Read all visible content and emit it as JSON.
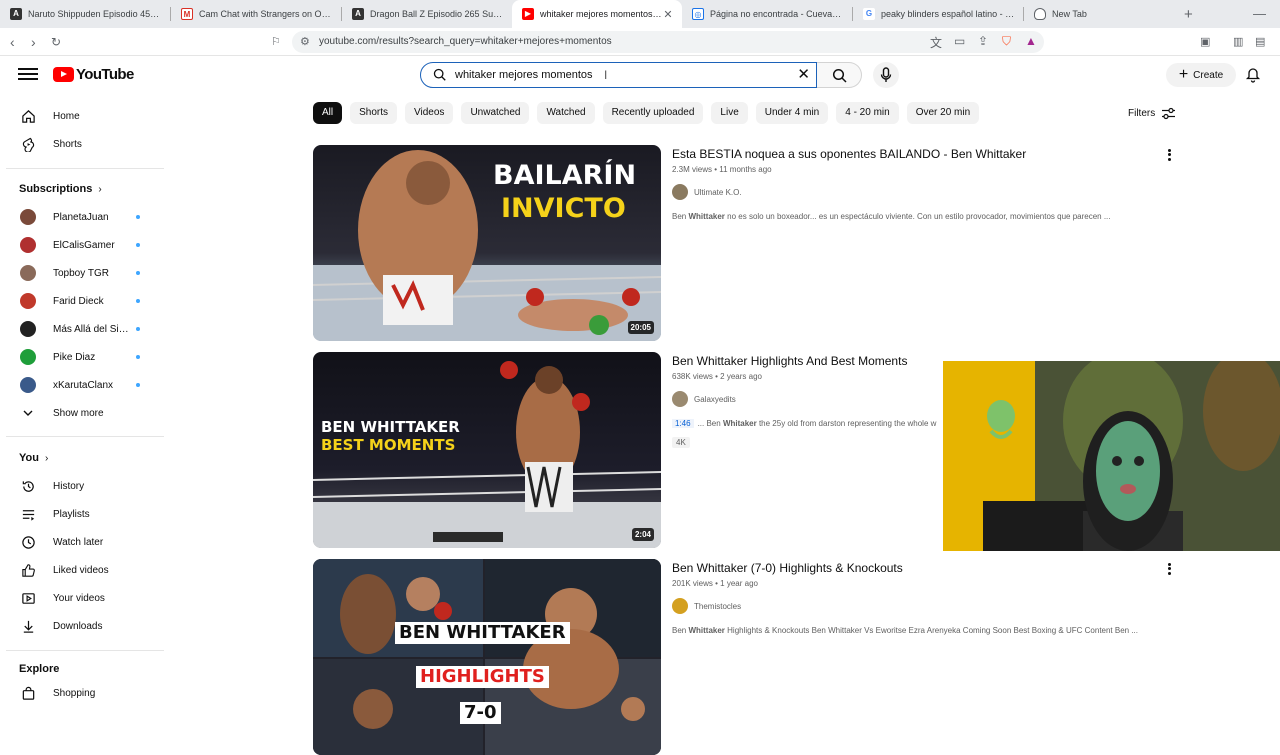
{
  "browser": {
    "tabs": [
      {
        "title": "Naruto Shippuden Episodio 459 Sub",
        "favicon": "af-icon",
        "active": false
      },
      {
        "title": "Cam Chat with Strangers on OmeTV",
        "favicon": "gmail-icon",
        "active": false
      },
      {
        "title": "Dragon Ball Z Episodio 265 Sub Espa",
        "favicon": "af-icon",
        "active": false
      },
      {
        "title": "whitaker mejores momentos - Y",
        "favicon": "youtube-icon",
        "active": true
      },
      {
        "title": "Página no encontrada - Cuevana 3",
        "favicon": "cuevana-icon",
        "active": false
      },
      {
        "title": "peaky blinders español latino - Goog",
        "favicon": "google-icon",
        "active": false
      },
      {
        "title": "New Tab",
        "favicon": "brave-icon",
        "active": false
      }
    ],
    "url": "youtube.com/results?search_query=whitaker+mejores+momentos"
  },
  "header": {
    "logo_text": "YouTube",
    "search_query": "whitaker mejores momentos",
    "create_label": "Create"
  },
  "sidebar": {
    "main": [
      {
        "label": "Home",
        "icon": "home-icon"
      },
      {
        "label": "Shorts",
        "icon": "shorts-icon"
      }
    ],
    "subscriptions_title": "Subscriptions",
    "subscriptions": [
      {
        "name": "PlanetaJuan",
        "color": "#7a4a3a"
      },
      {
        "name": "ElCalisGamer",
        "color": "#b03030"
      },
      {
        "name": "Topboy TGR",
        "color": "#8a6a5a"
      },
      {
        "name": "Farid Dieck",
        "color": "#c0392b"
      },
      {
        "name": "Más Allá del Sile...",
        "color": "#222222"
      },
      {
        "name": "Pike Diaz",
        "color": "#1f9e3a"
      },
      {
        "name": "xKarutaClanx",
        "color": "#3a5a8a"
      }
    ],
    "show_more": "Show more",
    "you_title": "You",
    "you": [
      {
        "label": "History",
        "icon": "history-icon"
      },
      {
        "label": "Playlists",
        "icon": "playlists-icon"
      },
      {
        "label": "Watch later",
        "icon": "watch-later-icon"
      },
      {
        "label": "Liked videos",
        "icon": "thumbs-up-icon"
      },
      {
        "label": "Your videos",
        "icon": "your-videos-icon"
      },
      {
        "label": "Downloads",
        "icon": "download-icon"
      }
    ],
    "explore_title": "Explore",
    "explore": [
      {
        "label": "Shopping",
        "icon": "shopping-bag-icon"
      }
    ]
  },
  "chips": [
    "All",
    "Shorts",
    "Videos",
    "Unwatched",
    "Watched",
    "Recently uploaded",
    "Live",
    "Under 4 min",
    "4 - 20 min",
    "Over 20 min"
  ],
  "filters_label": "Filters",
  "results": [
    {
      "title": "Esta BESTIA noquea a sus oponentes BAILANDO - Ben Whittaker",
      "meta": "2.3M views • 11 months ago",
      "channel": "Ultimate K.O.",
      "desc_pre": "Ben ",
      "desc_bold": "Whittaker",
      "desc_post": " no es solo un boxeador... es un espectáculo viviente. Con un estilo provocador, movimientos que parecen ...",
      "duration": "20:05",
      "thumb_line1": "BAILARÍN",
      "thumb_line2": "INVICTO"
    },
    {
      "title": "Ben Whittaker Highlights And Best Moments",
      "meta": "638K views • 2 years ago",
      "channel": "Galaxyedits",
      "chapter": "1:46",
      "desc_pre": "... Ben ",
      "desc_bold": "Whitaker",
      "desc_post": " the 25y old from darston representing the whole w",
      "badge": "4K",
      "duration": "2:04",
      "thumb_line1": "BEN WHITTAKER",
      "thumb_line2": "BEST MOMENTS"
    },
    {
      "title": "Ben Whittaker (7-0) Highlights & Knockouts",
      "meta": "201K views • 1 year ago",
      "channel": "Themistocles",
      "desc_pre": "Ben ",
      "desc_bold": "Whittaker",
      "desc_post": " Highlights & Knockouts Ben Whittaker Vs Eworitse Ezra Arenyeka Coming Soon Best Boxing & UFC Content Ben ...",
      "thumb_line1": "BEN WHITTAKER",
      "thumb_line2": "HIGHLIGHTS",
      "thumb_line3": "7-0"
    }
  ]
}
